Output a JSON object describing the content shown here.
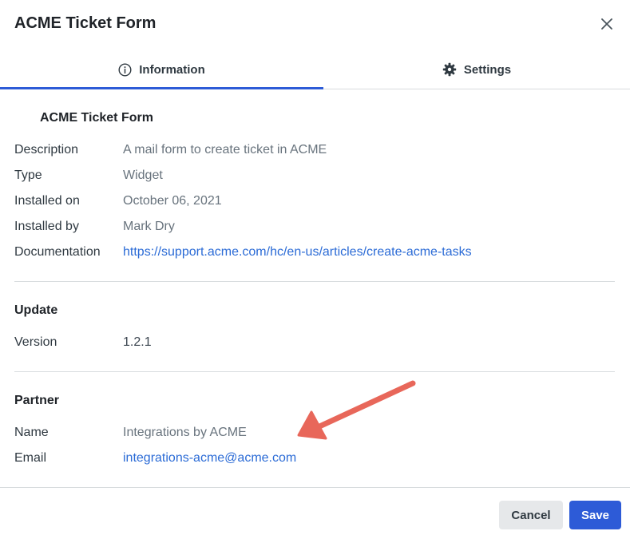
{
  "dialog": {
    "title": "ACME Ticket Form"
  },
  "tabs": [
    {
      "label": "Information",
      "icon": "info-circle-icon",
      "active": true
    },
    {
      "label": "Settings",
      "icon": "gear-icon",
      "active": false
    }
  ],
  "info": {
    "heading": "ACME Ticket Form",
    "rows": [
      {
        "label": "Description",
        "value": "A mail form to create ticket in ACME"
      },
      {
        "label": "Type",
        "value": "Widget"
      },
      {
        "label": "Installed on",
        "value": "October 06, 2021"
      },
      {
        "label": "Installed by",
        "value": "Mark Dry"
      },
      {
        "label": "Documentation",
        "value": "https://support.acme.com/hc/en-us/articles/create-acme-tasks"
      }
    ]
  },
  "update": {
    "heading": "Update",
    "version_label": "Version",
    "version_value": "1.2.1"
  },
  "partner": {
    "heading": "Partner",
    "name_label": "Name",
    "name_value": "Integrations by ACME",
    "email_label": "Email",
    "email_value": "integrations-acme@acme.com"
  },
  "footer": {
    "cancel_label": "Cancel",
    "save_label": "Save"
  },
  "colors": {
    "accent": "#2d5bd7",
    "link": "#2b6bd6",
    "annotation_arrow": "#e8675a"
  }
}
